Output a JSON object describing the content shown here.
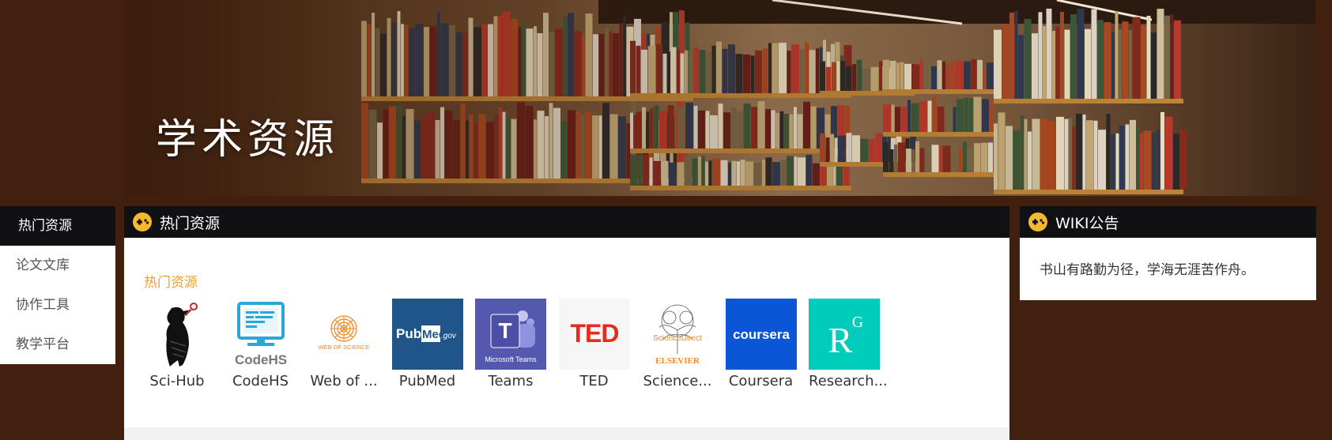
{
  "banner": {
    "title": "学术资源"
  },
  "leftnav": {
    "items": [
      {
        "label": "热门资源",
        "active": true
      },
      {
        "label": "论文文库",
        "active": false
      },
      {
        "label": "协作工具",
        "active": false
      },
      {
        "label": "教学平台",
        "active": false
      }
    ]
  },
  "main": {
    "header": "热门资源",
    "section_label": "热门资源",
    "resources": [
      {
        "name": "Sci-Hub",
        "icon": "scihub-raven-icon"
      },
      {
        "name": "CodeHS",
        "icon": "codehs-icon",
        "logo_text": "CodeHS"
      },
      {
        "name": "Web of ...",
        "icon": "web-of-science-icon",
        "logo_text": "WEB OF SCIENCE"
      },
      {
        "name": "PubMed",
        "icon": "pubmed-icon",
        "logo_text_a": "Pub",
        "logo_text_b": "Med",
        "logo_text_c": ".gov"
      },
      {
        "name": "Teams",
        "icon": "microsoft-teams-icon",
        "logo_text": "Microsoft Teams"
      },
      {
        "name": "TED",
        "icon": "ted-icon",
        "logo_text": "TED"
      },
      {
        "name": "Science...",
        "icon": "sciencedirect-elsevier-icon",
        "logo_text_a": "ScienceDirect",
        "logo_text_b": "ELSEVIER"
      },
      {
        "name": "Coursera",
        "icon": "coursera-icon",
        "logo_text": "coursera"
      },
      {
        "name": "Research...",
        "icon": "researchgate-icon",
        "logo_text_a": "R",
        "logo_text_b": "G"
      }
    ]
  },
  "wiki": {
    "header": "WIKI公告",
    "text": "书山有路勤为径，学海无涯苦作舟。"
  },
  "colors": {
    "page_bg": "#42200f",
    "header_bg": "#111114",
    "accent_orange": "#f0a030",
    "icon_yellow": "#f5b82e"
  }
}
